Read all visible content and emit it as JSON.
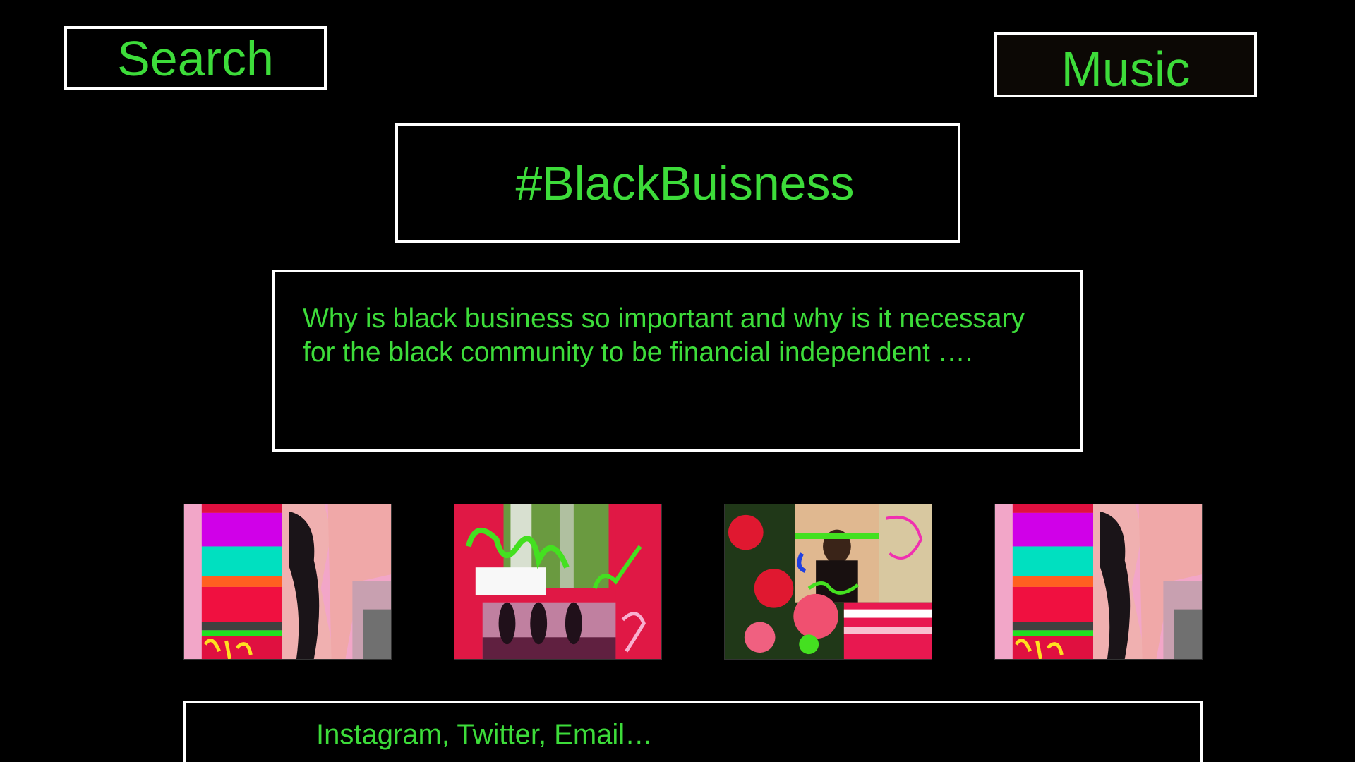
{
  "nav": {
    "search_label": "Search",
    "music_label": "Music"
  },
  "header": {
    "title": "#BlackBuisness"
  },
  "description": {
    "line1": "Why is black business so important and why is it necessary",
    "line2": "for the black community to be financial independent …."
  },
  "gallery": {
    "images": [
      {
        "name": "collage-figure-image"
      },
      {
        "name": "collage-silhouettes-image"
      },
      {
        "name": "collage-flowers-portrait-image"
      },
      {
        "name": "collage-figure-image-repeat"
      }
    ]
  },
  "footer": {
    "contact_text": "Instagram, Twitter, Email…"
  },
  "colors": {
    "background": "#000000",
    "text": "#3ddc3a",
    "border": "#ffffff"
  }
}
